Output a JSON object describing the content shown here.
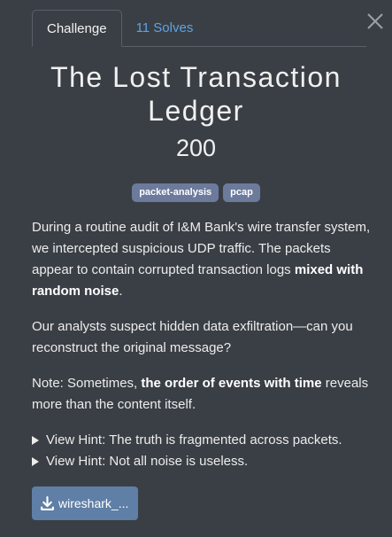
{
  "tabs": [
    {
      "label": "Challenge"
    },
    {
      "label": "11 Solves"
    }
  ],
  "challenge": {
    "title": "The Lost Transaction Ledger",
    "value": "200",
    "tags": [
      "packet-analysis",
      "pcap"
    ],
    "description": {
      "p1_text": "During a routine audit of I&M Bank's wire transfer system, we intercepted suspicious UDP traffic. The packets appear to contain corrupted transaction logs ",
      "p1_bold": "mixed with random noise",
      "p1_end": ".",
      "p2": "Our analysts suspect hidden data exfiltration—can you reconstruct the original message?",
      "p3_text": "Note: Sometimes, ",
      "p3_bold": "the order of events with time",
      "p3_end": " reveals more than the content itself."
    },
    "hints": [
      "View Hint: The truth is fragmented across packets.",
      "View Hint: Not all noise is useless."
    ],
    "file": {
      "label": "wireshark_...",
      "icon": "download-icon"
    }
  },
  "colors": {
    "background": "#3a3f45",
    "link": "#5da3e6",
    "tag": "#6c7a9c",
    "file_button": "#5f7fa6"
  }
}
